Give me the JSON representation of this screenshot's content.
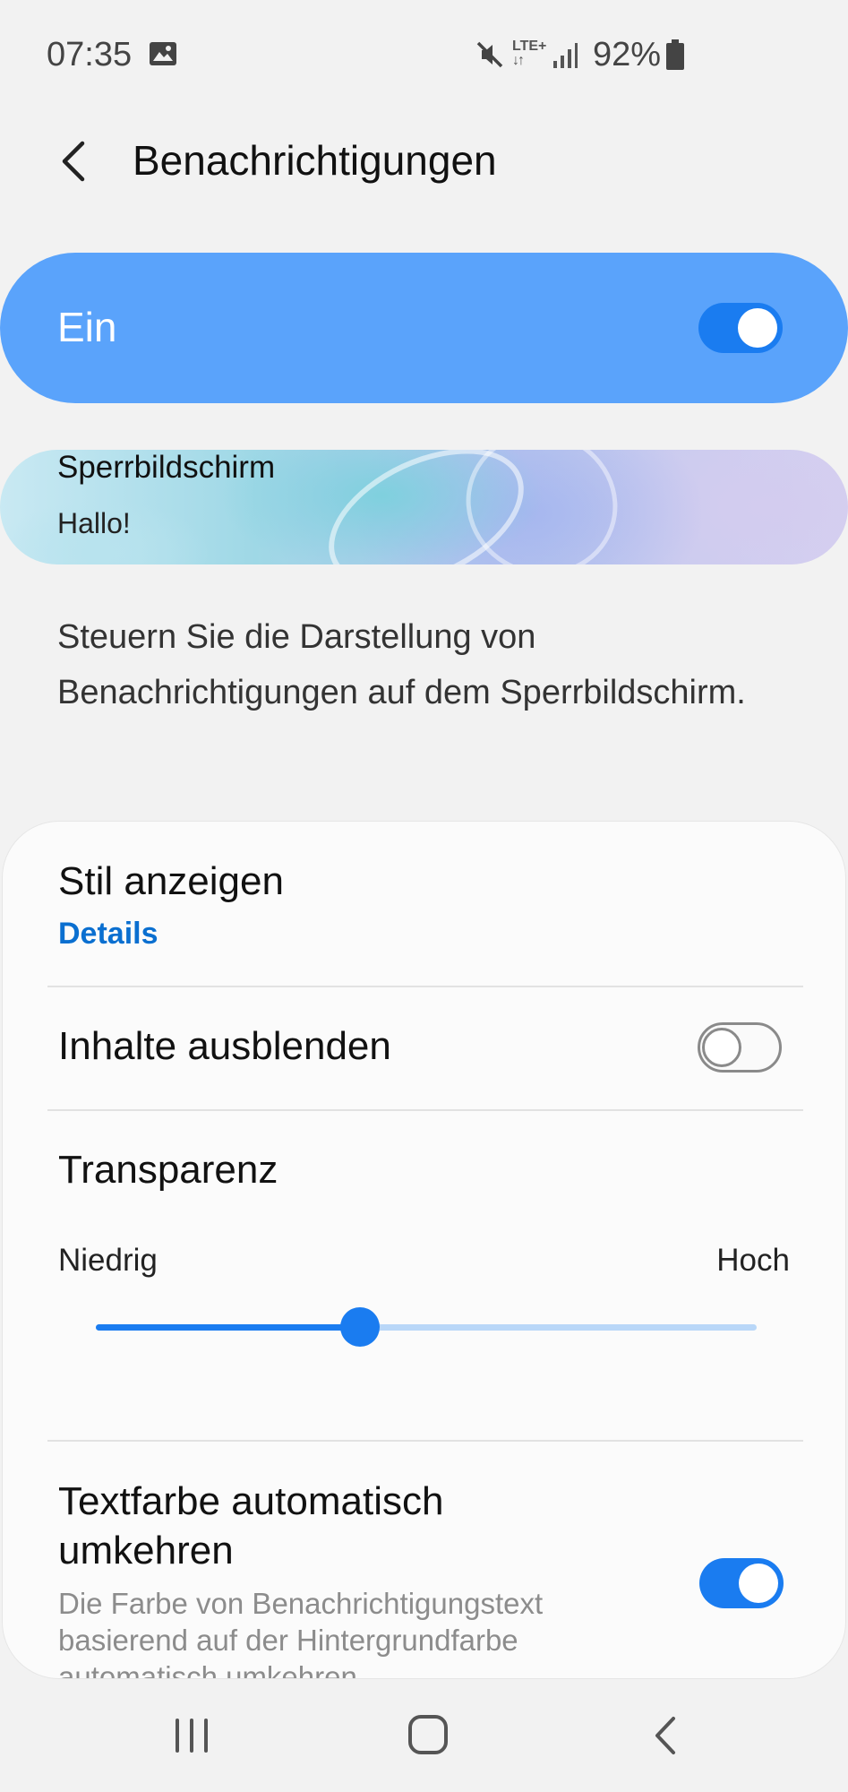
{
  "status_bar": {
    "time": "07:35",
    "network": "LTE+",
    "battery": "92%",
    "icons": [
      "image-icon",
      "mute-icon",
      "lte-icon",
      "signal-icon",
      "battery-icon"
    ]
  },
  "header": {
    "title": "Benachrichtigungen",
    "back_icon": "back-arrow-icon"
  },
  "master": {
    "label": "Ein",
    "enabled": true
  },
  "lock_preview": {
    "title": "Sperrbildschirm",
    "subtitle": "Hallo!"
  },
  "description": "Steuern Sie die Darstellung von Benachrichtigungen auf dem Sperrbildschirm.",
  "settings": {
    "style": {
      "title": "Stil anzeigen",
      "link": "Details"
    },
    "hide_content": {
      "title": "Inhalte ausblenden",
      "enabled": false
    },
    "transparency": {
      "title": "Transparenz",
      "min_label": "Niedrig",
      "max_label": "Hoch",
      "value_fraction": 0.4
    },
    "invert_text": {
      "title_line1": "Textfarbe automatisch",
      "title_line2": "umkehren",
      "description": "Die Farbe von Benachrichtigungstext basierend auf der Hintergrundfarbe automatisch umkehren.",
      "enabled": true
    }
  },
  "nav_bar": {
    "icons": [
      "recent-apps-icon",
      "home-icon",
      "back-icon"
    ]
  },
  "colors": {
    "accent": "#1a7cf0",
    "master_bar": "#5aa3fb",
    "link": "#0a6fd0",
    "background": "#f2f2f2"
  }
}
